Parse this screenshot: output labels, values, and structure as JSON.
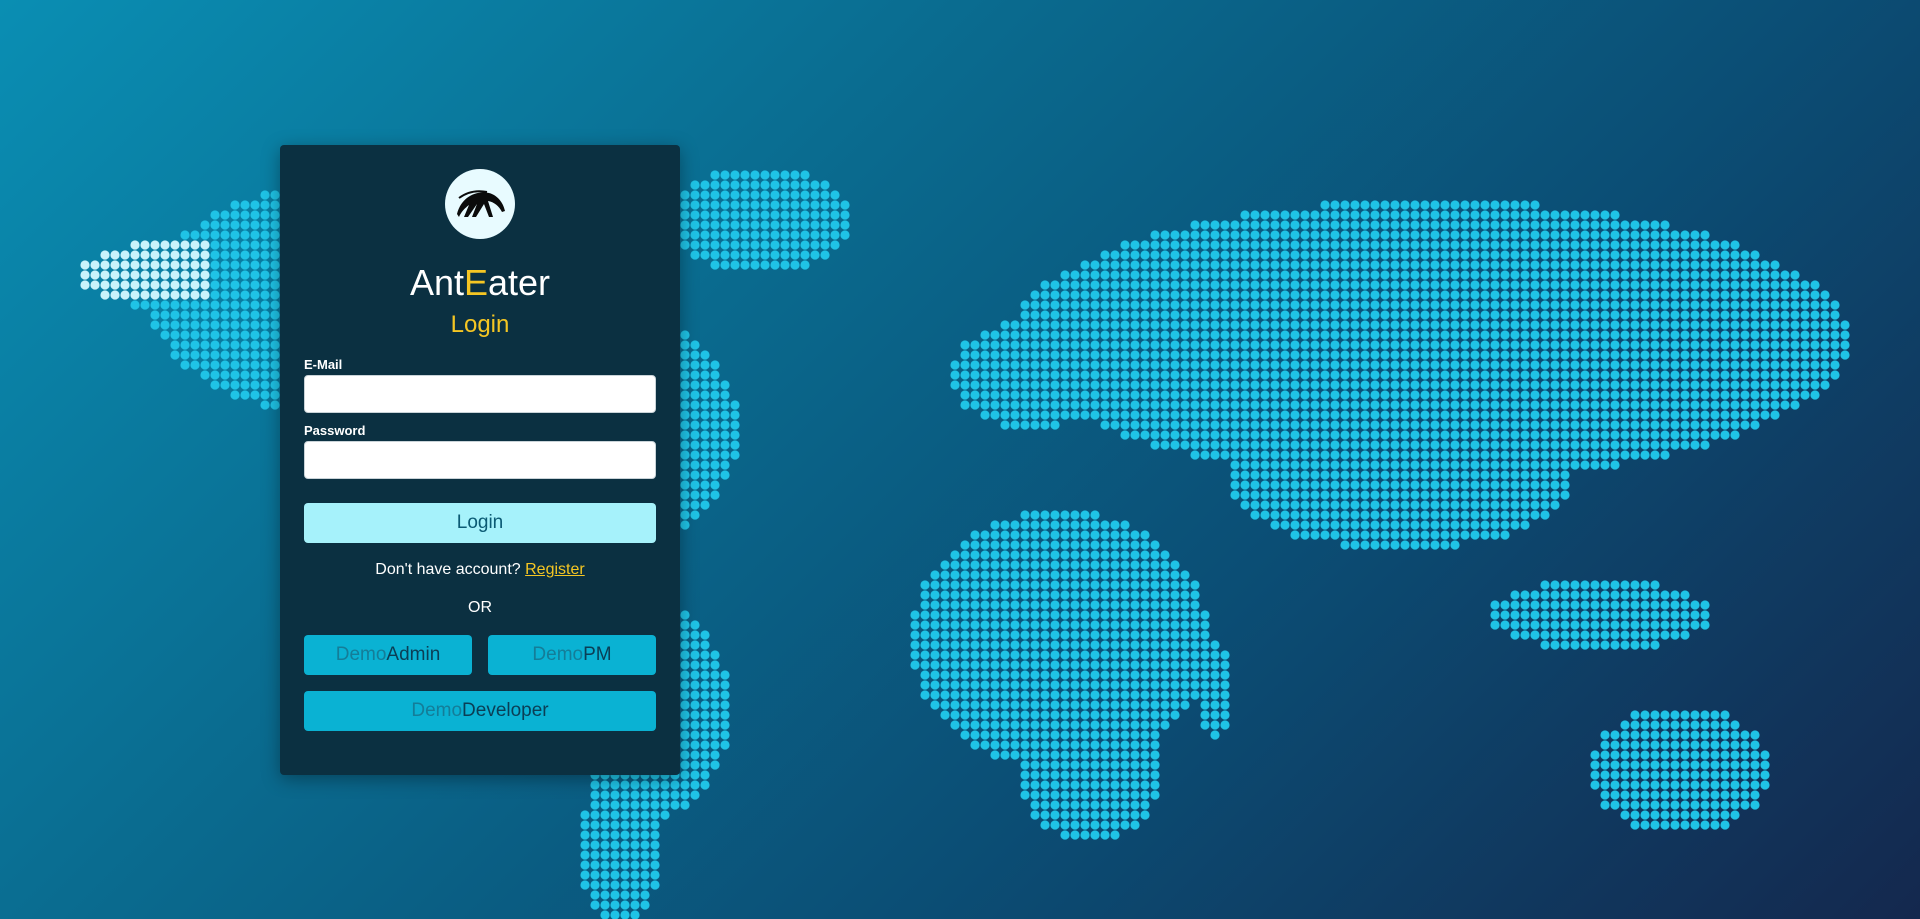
{
  "brand": {
    "part1": "Ant",
    "part2": "E",
    "part3": "ater"
  },
  "login_title": "Login",
  "form": {
    "email_label": "E-Mail",
    "email_value": "",
    "password_label": "Password",
    "password_value": "",
    "submit_label": "Login"
  },
  "register": {
    "prompt": "Don't have account?",
    "link_label": "Register"
  },
  "or_label": "OR",
  "demo": {
    "admin": {
      "prefix": "Demo",
      "role": "Admin"
    },
    "pm": {
      "prefix": "Demo",
      "role": "PM"
    },
    "developer": {
      "prefix": "Demo",
      "role": "Developer"
    }
  },
  "icons": {
    "logo": "anteater-logo-icon"
  },
  "colors": {
    "accent": "#f5c623",
    "card": "#0b3041",
    "primary_button": "#a6f2fb",
    "demo_button": "#0ab2d3",
    "map_dot": "#1fc3e6"
  }
}
